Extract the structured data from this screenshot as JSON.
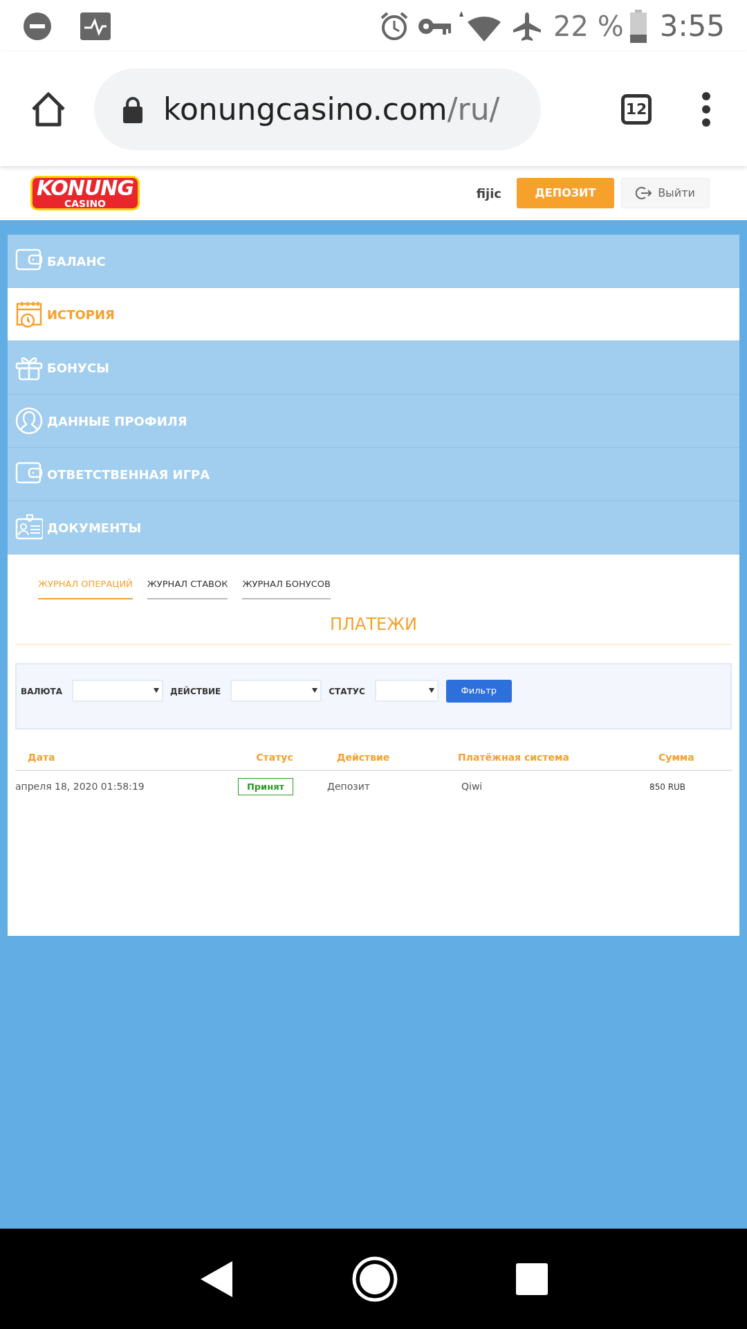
{
  "status_bar": {
    "battery": "22 %",
    "time": "3:55"
  },
  "browser": {
    "url_host": "konungcasino.com",
    "url_path": "/ru/",
    "tab_count": "12"
  },
  "header": {
    "logo_top": "KONUNG",
    "logo_bottom": "CASINO",
    "username": "fijic",
    "deposit_button": "ДЕПОЗИТ",
    "logout_button": "Выйти"
  },
  "menu": [
    {
      "label": "БАЛАНС",
      "selected": false
    },
    {
      "label": "ИСТОРИЯ",
      "selected": true
    },
    {
      "label": "БОНУСЫ",
      "selected": false
    },
    {
      "label": "ДАННЫЕ ПРОФИЛЯ",
      "selected": false
    },
    {
      "label": "ОТВЕТСТВЕННАЯ ИГРА",
      "selected": false
    },
    {
      "label": "ДОКУМЕНТЫ",
      "selected": false
    }
  ],
  "tabs": [
    {
      "label": "ЖУРНАЛ ОПЕРАЦИЙ",
      "selected": true
    },
    {
      "label": "ЖУРНАЛ СТАВОК",
      "selected": false
    },
    {
      "label": "ЖУРНАЛ БОНУСОВ",
      "selected": false
    }
  ],
  "section_title": "ПЛАТЕЖИ",
  "filter": {
    "fields": [
      {
        "label": "ВАЛЮТА"
      },
      {
        "label": "ДЕЙСТВИЕ"
      },
      {
        "label": "СТАТУС"
      }
    ],
    "button": "Фильтр"
  },
  "table": {
    "columns": [
      "Дата",
      "Статус",
      "Действие",
      "Платёжная система",
      "Сумма"
    ],
    "rows": [
      {
        "date": "апреля 18, 2020 01:58:19",
        "status": "Принят",
        "action": "Депозит",
        "system": "Qiwi",
        "amount": "850 RUB"
      }
    ]
  }
}
